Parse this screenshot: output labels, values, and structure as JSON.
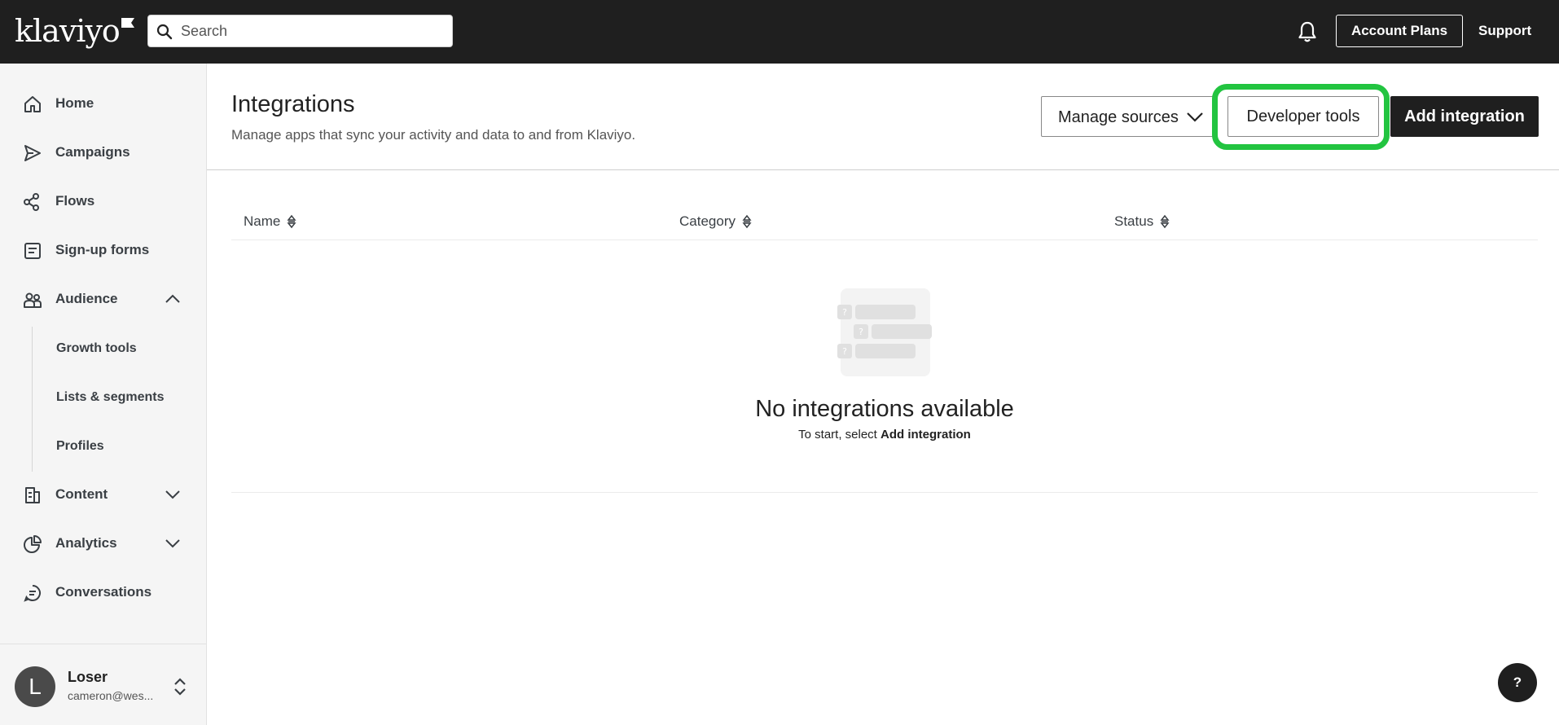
{
  "topbar": {
    "logo": "klaviyo",
    "search_placeholder": "Search",
    "account_plans": "Account Plans",
    "support": "Support"
  },
  "sidebar": {
    "items": [
      {
        "label": "Home",
        "icon": "home-icon"
      },
      {
        "label": "Campaigns",
        "icon": "send-icon"
      },
      {
        "label": "Flows",
        "icon": "flows-icon"
      },
      {
        "label": "Sign-up forms",
        "icon": "form-icon"
      },
      {
        "label": "Audience",
        "icon": "people-icon",
        "expanded": true
      },
      {
        "label": "Content",
        "icon": "content-icon",
        "expanded": false
      },
      {
        "label": "Analytics",
        "icon": "pie-chart-icon",
        "expanded": false
      },
      {
        "label": "Conversations",
        "icon": "chat-icon"
      }
    ],
    "audience_sub": [
      "Growth tools",
      "Lists & segments",
      "Profiles"
    ],
    "user": {
      "initial": "L",
      "name": "Loser",
      "email": "cameron@wes..."
    }
  },
  "main": {
    "title": "Integrations",
    "subtitle": "Manage apps that sync your activity and data to and from Klaviyo.",
    "buttons": {
      "manage_sources": "Manage sources",
      "developer_tools": "Developer tools",
      "add_integration": "Add integration"
    },
    "columns": [
      "Name",
      "Category",
      "Status"
    ],
    "empty": {
      "title": "No integrations available",
      "prefix": "To start, select ",
      "action": "Add integration"
    }
  },
  "help": "?",
  "colors": {
    "topbar": "#1f1f1f",
    "sidebar": "#f5f5f5",
    "highlight": "#22c440"
  }
}
